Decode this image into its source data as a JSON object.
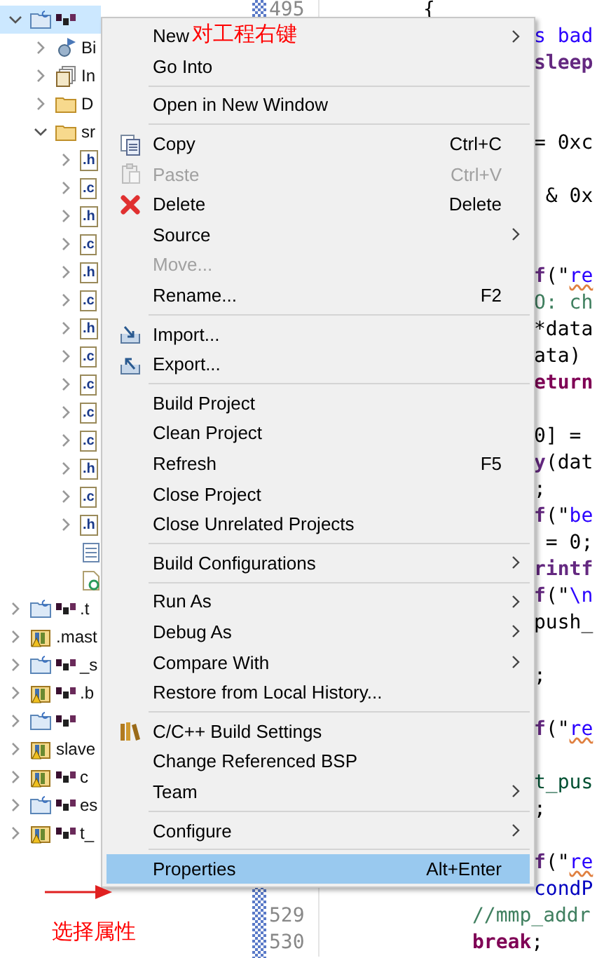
{
  "tree": [
    {
      "kind": "c-project",
      "redacted": true,
      "expanded": true,
      "selected": true,
      "children": [
        {
          "kind": "binaries",
          "label": "Bi",
          "expanded": false,
          "selected": false
        },
        {
          "kind": "includes",
          "label": "In",
          "expanded": false,
          "selected": false
        },
        {
          "kind": "folder",
          "label": "D",
          "expanded": false,
          "selected": false
        },
        {
          "kind": "folder",
          "label": "sr",
          "expanded": true,
          "selected": false,
          "children": [
            {
              "kind": "file",
              "ext": ".h",
              "expanded": false,
              "selected": false
            },
            {
              "kind": "file",
              "ext": ".c",
              "expanded": false,
              "selected": false
            },
            {
              "kind": "file",
              "ext": ".h",
              "expanded": false,
              "selected": false
            },
            {
              "kind": "file",
              "ext": ".c",
              "expanded": false,
              "selected": false
            },
            {
              "kind": "file",
              "ext": ".h",
              "expanded": false,
              "selected": false
            },
            {
              "kind": "file",
              "ext": ".c",
              "expanded": false,
              "selected": false
            },
            {
              "kind": "file",
              "ext": ".h",
              "expanded": false,
              "selected": false
            },
            {
              "kind": "file",
              "ext": ".c",
              "expanded": false,
              "selected": false
            },
            {
              "kind": "file",
              "ext": ".c",
              "expanded": false,
              "selected": false
            },
            {
              "kind": "file",
              "ext": ".c",
              "expanded": false,
              "selected": false
            },
            {
              "kind": "file",
              "ext": ".c",
              "expanded": false,
              "selected": false
            },
            {
              "kind": "file",
              "ext": ".h",
              "expanded": false,
              "selected": false
            },
            {
              "kind": "file",
              "ext": ".c",
              "expanded": false,
              "selected": false
            },
            {
              "kind": "file",
              "ext": ".h",
              "expanded": false,
              "selected": false
            },
            {
              "kind": "bin-file",
              "selected": false
            },
            {
              "kind": "gear-file",
              "selected": false
            }
          ]
        }
      ]
    },
    {
      "kind": "c-project",
      "label": ".t",
      "redacted": true,
      "expanded": false,
      "selected": false
    },
    {
      "kind": "lib-project",
      "label": ".mast",
      "expanded": false,
      "selected": false
    },
    {
      "kind": "c-project",
      "label": "_s",
      "redacted": true,
      "expanded": false,
      "selected": false
    },
    {
      "kind": "lib-project",
      "label": ".b",
      "redacted": true,
      "expanded": false,
      "selected": false
    },
    {
      "kind": "c-project",
      "redacted": true,
      "expanded": false,
      "selected": false
    },
    {
      "kind": "lib-project",
      "label": "slave",
      "expanded": false,
      "selected": false
    },
    {
      "kind": "lib-project",
      "label": "c",
      "redacted": true,
      "expanded": false,
      "selected": false
    },
    {
      "kind": "c-project",
      "label": "es",
      "redacted": true,
      "expanded": false,
      "selected": false
    },
    {
      "kind": "lib-project",
      "label": "t_",
      "redacted": true,
      "expanded": false,
      "selected": false
    }
  ],
  "code_lines": [
    {
      "kind": "brace",
      "number": "495",
      "segments": [
        {
          "kind": "plain",
          "text": "{"
        }
      ]
    },
    {
      "kind": "cut",
      "segments": [
        {
          "kind": "str",
          "text": "s bad"
        }
      ]
    },
    {
      "kind": "cut",
      "segments": [
        {
          "kind": "fn",
          "text": "sleep"
        }
      ]
    },
    {
      "kind": "blank"
    },
    {
      "kind": "blank"
    },
    {
      "kind": "cut",
      "segments": [
        {
          "kind": "plain",
          "text": "= 0xc"
        }
      ]
    },
    {
      "kind": "blank"
    },
    {
      "kind": "cut",
      "segments": [
        {
          "kind": "plain",
          "text": " & 0x"
        }
      ]
    },
    {
      "kind": "blank"
    },
    {
      "kind": "blank"
    },
    {
      "kind": "cut",
      "segments": [
        {
          "kind": "fn",
          "text": "f"
        },
        {
          "kind": "plain",
          "text": "(\""
        },
        {
          "kind": "typo",
          "text": "re"
        }
      ]
    },
    {
      "kind": "cut",
      "segments": [
        {
          "kind": "comment",
          "text": "O: ch"
        }
      ]
    },
    {
      "kind": "cut",
      "segments": [
        {
          "kind": "plain",
          "text": "*data"
        }
      ]
    },
    {
      "kind": "cut",
      "segments": [
        {
          "kind": "plain",
          "text": "ata)"
        }
      ]
    },
    {
      "kind": "cut",
      "segments": [
        {
          "kind": "kw",
          "text": "eturn"
        }
      ]
    },
    {
      "kind": "blank"
    },
    {
      "kind": "cut",
      "segments": [
        {
          "kind": "plain",
          "text": "0] ="
        }
      ]
    },
    {
      "kind": "cut",
      "segments": [
        {
          "kind": "fn",
          "text": "y"
        },
        {
          "kind": "plain",
          "text": "(dat"
        }
      ]
    },
    {
      "kind": "cut",
      "segments": [
        {
          "kind": "plain",
          "text": ";"
        }
      ]
    },
    {
      "kind": "cut",
      "segments": [
        {
          "kind": "fn",
          "text": "f"
        },
        {
          "kind": "plain",
          "text": "(\""
        },
        {
          "kind": "str",
          "text": "be"
        }
      ]
    },
    {
      "kind": "cut",
      "segments": [
        {
          "kind": "plain",
          "text": " = 0;"
        }
      ]
    },
    {
      "kind": "cut",
      "segments": [
        {
          "kind": "fn",
          "text": "rintf"
        }
      ]
    },
    {
      "kind": "cut",
      "segments": [
        {
          "kind": "fn",
          "text": "f"
        },
        {
          "kind": "plain",
          "text": "(\""
        },
        {
          "kind": "str",
          "text": "\\n"
        }
      ]
    },
    {
      "kind": "cut",
      "segments": [
        {
          "kind": "plain",
          "text": "push_"
        }
      ]
    },
    {
      "kind": "blank"
    },
    {
      "kind": "cut",
      "segments": [
        {
          "kind": "plain",
          "text": ";"
        }
      ]
    },
    {
      "kind": "blank"
    },
    {
      "kind": "cut",
      "segments": [
        {
          "kind": "fn",
          "text": "f"
        },
        {
          "kind": "plain",
          "text": "(\""
        },
        {
          "kind": "typo",
          "text": "re"
        }
      ]
    },
    {
      "kind": "blank"
    },
    {
      "kind": "cut",
      "segments": [
        {
          "kind": "type",
          "text": "t_pus"
        }
      ]
    },
    {
      "kind": "cut",
      "segments": [
        {
          "kind": "plain",
          "text": ";"
        }
      ]
    },
    {
      "kind": "blank"
    },
    {
      "kind": "cut",
      "segments": [
        {
          "kind": "fn",
          "text": "f"
        },
        {
          "kind": "plain",
          "text": "(\""
        },
        {
          "kind": "typo",
          "text": "re"
        }
      ]
    },
    {
      "kind": "cut",
      "segments": [
        {
          "kind": "field",
          "text": "condP"
        }
      ]
    },
    {
      "kind": "stmt",
      "number": "529",
      "segments": [
        {
          "kind": "comment",
          "text": "//mmp_addr"
        }
      ]
    },
    {
      "kind": "stmt",
      "number": "530",
      "segments": [
        {
          "kind": "kw",
          "text": "break"
        },
        {
          "kind": "plain",
          "text": ";"
        }
      ]
    }
  ],
  "context_menu": [
    {
      "kind": "item",
      "label": "New",
      "submenu": true,
      "disabled": false,
      "selected": false
    },
    {
      "kind": "item",
      "label": "Go Into",
      "submenu": false,
      "disabled": false,
      "selected": false
    },
    {
      "kind": "separator"
    },
    {
      "kind": "item",
      "label": "Open in New Window",
      "submenu": false,
      "disabled": false,
      "selected": false
    },
    {
      "kind": "separator"
    },
    {
      "kind": "item",
      "label": "Copy",
      "shortcut": "Ctrl+C",
      "submenu": false,
      "disabled": false,
      "selected": false
    },
    {
      "kind": "item",
      "label": "Paste",
      "shortcut": "Ctrl+V",
      "submenu": false,
      "disabled": true,
      "selected": false
    },
    {
      "kind": "item",
      "label": "Delete",
      "shortcut": "Delete",
      "submenu": false,
      "disabled": false,
      "selected": false
    },
    {
      "kind": "item",
      "label": "Source",
      "submenu": true,
      "disabled": false,
      "selected": false
    },
    {
      "kind": "item",
      "label": "Move...",
      "submenu": false,
      "disabled": true,
      "selected": false
    },
    {
      "kind": "item",
      "label": "Rename...",
      "shortcut": "F2",
      "submenu": false,
      "disabled": false,
      "selected": false
    },
    {
      "kind": "separator"
    },
    {
      "kind": "item",
      "label": "Import...",
      "submenu": false,
      "disabled": false,
      "selected": false
    },
    {
      "kind": "item",
      "label": "Export...",
      "submenu": false,
      "disabled": false,
      "selected": false
    },
    {
      "kind": "separator"
    },
    {
      "kind": "item",
      "label": "Build Project",
      "submenu": false,
      "disabled": false,
      "selected": false
    },
    {
      "kind": "item",
      "label": "Clean Project",
      "submenu": false,
      "disabled": false,
      "selected": false
    },
    {
      "kind": "item",
      "label": "Refresh",
      "shortcut": "F5",
      "submenu": false,
      "disabled": false,
      "selected": false
    },
    {
      "kind": "item",
      "label": "Close Project",
      "submenu": false,
      "disabled": false,
      "selected": false
    },
    {
      "kind": "item",
      "label": "Close Unrelated Projects",
      "submenu": false,
      "disabled": false,
      "selected": false
    },
    {
      "kind": "separator"
    },
    {
      "kind": "item",
      "label": "Build Configurations",
      "submenu": true,
      "disabled": false,
      "selected": false
    },
    {
      "kind": "separator"
    },
    {
      "kind": "item",
      "label": "Run As",
      "submenu": true,
      "disabled": false,
      "selected": false
    },
    {
      "kind": "item",
      "label": "Debug As",
      "submenu": true,
      "disabled": false,
      "selected": false
    },
    {
      "kind": "item",
      "label": "Compare With",
      "submenu": true,
      "disabled": false,
      "selected": false
    },
    {
      "kind": "item",
      "label": "Restore from Local History...",
      "submenu": false,
      "disabled": false,
      "selected": false
    },
    {
      "kind": "separator"
    },
    {
      "kind": "item",
      "label": "C/C++ Build Settings",
      "submenu": false,
      "disabled": false,
      "selected": false
    },
    {
      "kind": "item",
      "label": "Change Referenced BSP",
      "submenu": false,
      "disabled": false,
      "selected": false
    },
    {
      "kind": "item",
      "label": "Team",
      "submenu": true,
      "disabled": false,
      "selected": false
    },
    {
      "kind": "separator"
    },
    {
      "kind": "item",
      "label": "Configure",
      "submenu": true,
      "disabled": false,
      "selected": false
    },
    {
      "kind": "separator"
    },
    {
      "kind": "item",
      "label": "Properties",
      "shortcut": "Alt+Enter",
      "submenu": false,
      "disabled": false,
      "selected": true
    }
  ],
  "annotations": {
    "menu_note": "对工程右键",
    "arrow_note": "选择属性"
  }
}
